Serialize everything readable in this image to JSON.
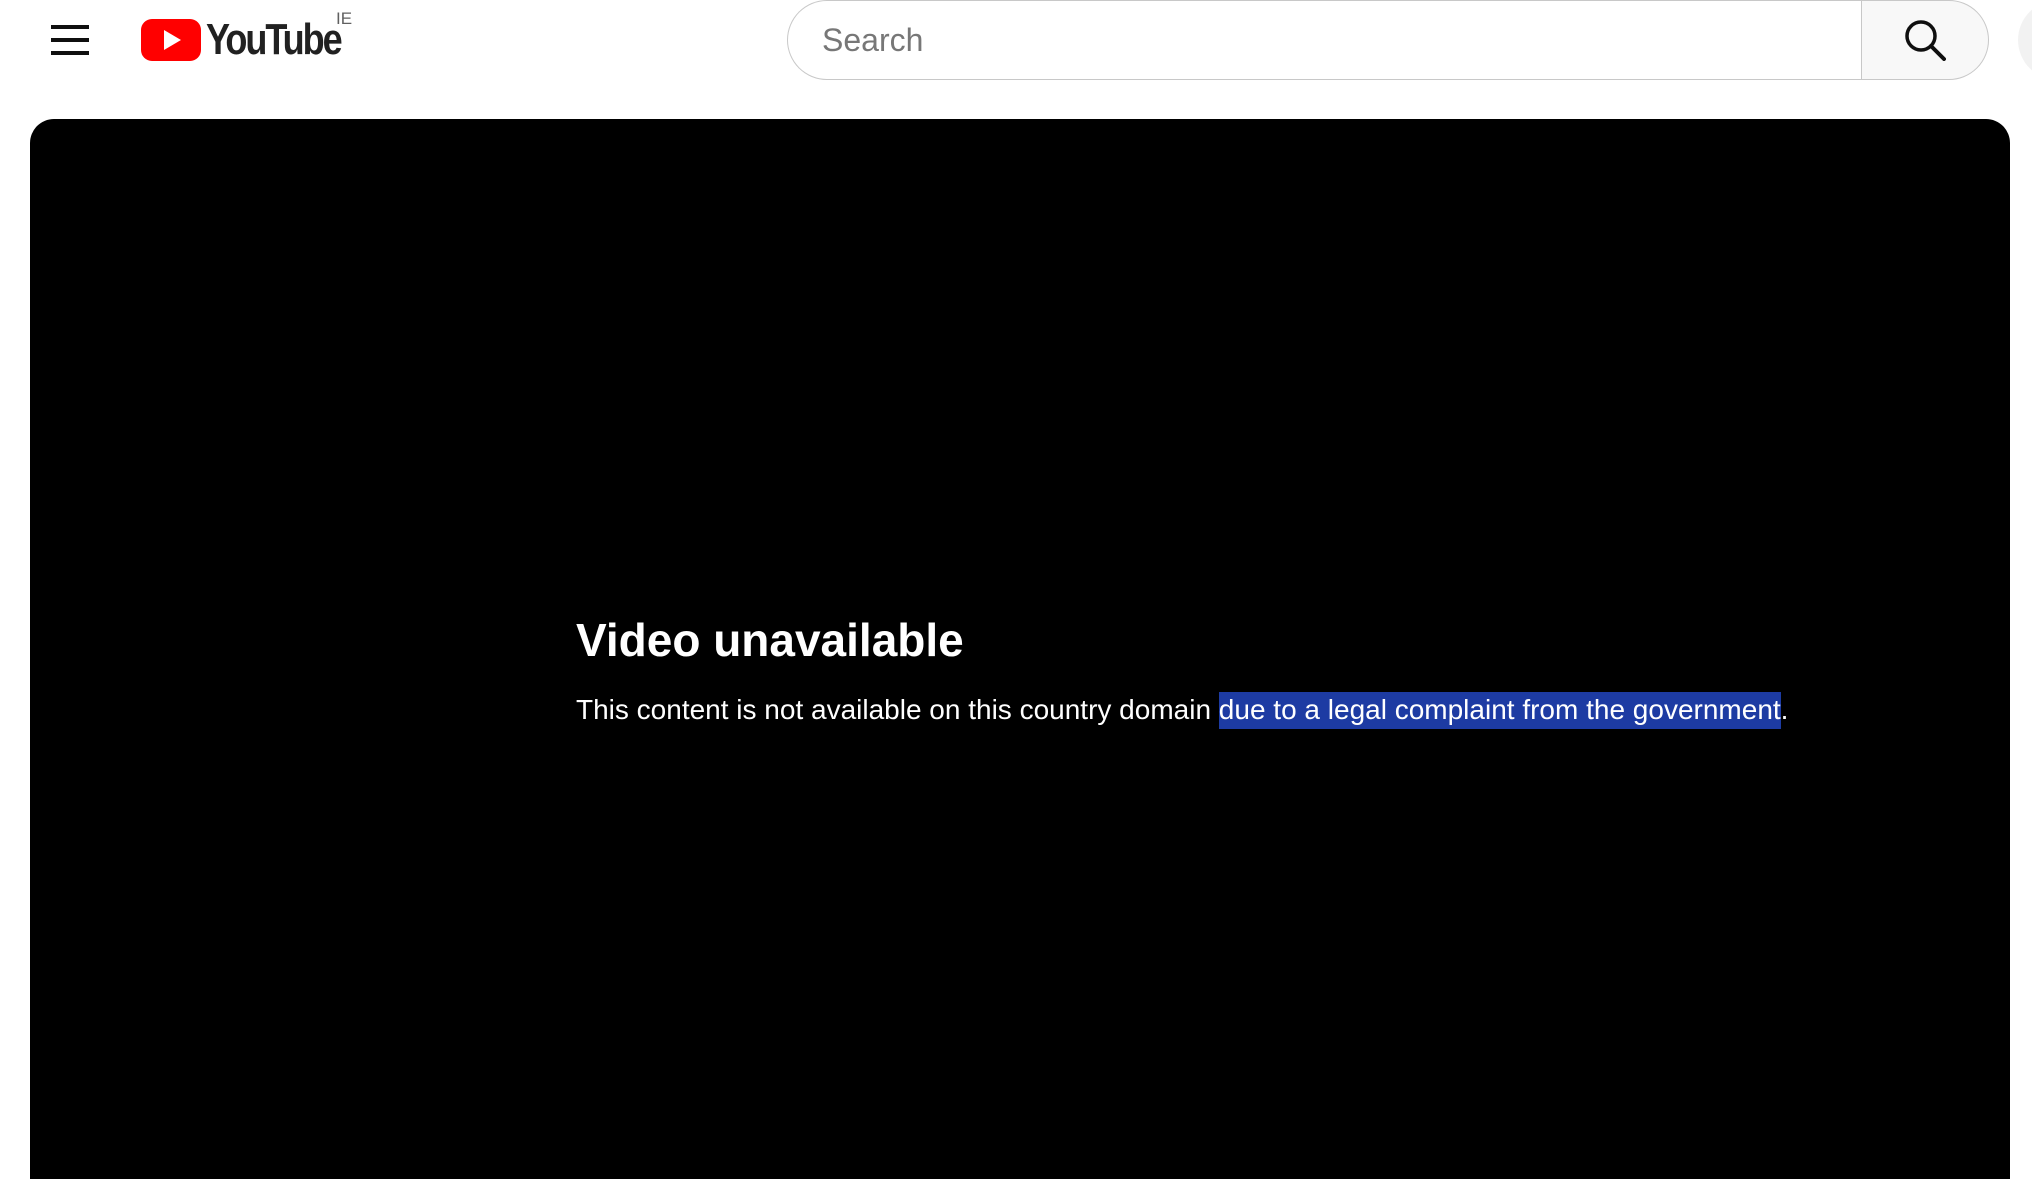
{
  "masthead": {
    "logo_text": "YouTube",
    "country_code": "IE",
    "search": {
      "placeholder": "Search",
      "value": ""
    },
    "icons": {
      "menu": "hamburger-menu-icon",
      "logo": "youtube-play-logo",
      "search": "search-icon"
    },
    "colors": {
      "brand_red": "#FF0000",
      "text": "#212121"
    }
  },
  "player": {
    "background": "#000000",
    "error": {
      "title": "Video unavailable",
      "reason_prefix": "This content is not available on this country domain ",
      "reason_selected": "due to a legal complaint from the government",
      "reason_suffix": ".",
      "selection_color": "#1D3BA3"
    }
  }
}
